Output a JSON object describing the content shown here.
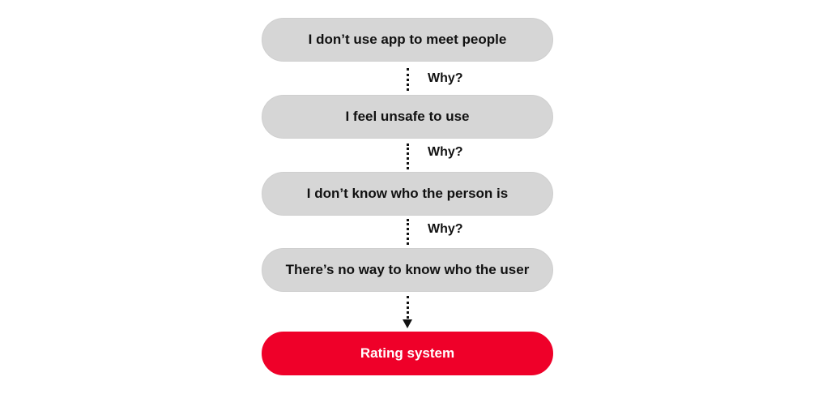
{
  "steps": [
    {
      "text": "I don’t use app to meet people"
    },
    {
      "text": "I feel unsafe to use"
    },
    {
      "text": "I don’t know who the person is"
    },
    {
      "text": "There’s no way to know who the user"
    }
  ],
  "connector_label": "Why?",
  "result": {
    "text": "Rating system"
  },
  "colors": {
    "step_fill": "#d6d6d6",
    "result_fill": "#ef0029",
    "text": "#111111"
  }
}
